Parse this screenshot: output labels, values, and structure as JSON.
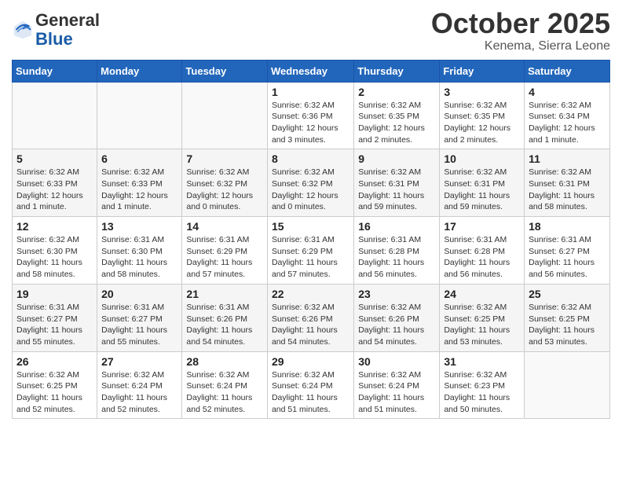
{
  "header": {
    "logo_line1": "General",
    "logo_line2": "Blue",
    "month": "October 2025",
    "location": "Kenema, Sierra Leone"
  },
  "weekdays": [
    "Sunday",
    "Monday",
    "Tuesday",
    "Wednesday",
    "Thursday",
    "Friday",
    "Saturday"
  ],
  "weeks": [
    [
      {
        "day": "",
        "info": ""
      },
      {
        "day": "",
        "info": ""
      },
      {
        "day": "",
        "info": ""
      },
      {
        "day": "1",
        "info": "Sunrise: 6:32 AM\nSunset: 6:36 PM\nDaylight: 12 hours and 3 minutes."
      },
      {
        "day": "2",
        "info": "Sunrise: 6:32 AM\nSunset: 6:35 PM\nDaylight: 12 hours and 2 minutes."
      },
      {
        "day": "3",
        "info": "Sunrise: 6:32 AM\nSunset: 6:35 PM\nDaylight: 12 hours and 2 minutes."
      },
      {
        "day": "4",
        "info": "Sunrise: 6:32 AM\nSunset: 6:34 PM\nDaylight: 12 hours and 1 minute."
      }
    ],
    [
      {
        "day": "5",
        "info": "Sunrise: 6:32 AM\nSunset: 6:33 PM\nDaylight: 12 hours and 1 minute."
      },
      {
        "day": "6",
        "info": "Sunrise: 6:32 AM\nSunset: 6:33 PM\nDaylight: 12 hours and 1 minute."
      },
      {
        "day": "7",
        "info": "Sunrise: 6:32 AM\nSunset: 6:32 PM\nDaylight: 12 hours and 0 minutes."
      },
      {
        "day": "8",
        "info": "Sunrise: 6:32 AM\nSunset: 6:32 PM\nDaylight: 12 hours and 0 minutes."
      },
      {
        "day": "9",
        "info": "Sunrise: 6:32 AM\nSunset: 6:31 PM\nDaylight: 11 hours and 59 minutes."
      },
      {
        "day": "10",
        "info": "Sunrise: 6:32 AM\nSunset: 6:31 PM\nDaylight: 11 hours and 59 minutes."
      },
      {
        "day": "11",
        "info": "Sunrise: 6:32 AM\nSunset: 6:31 PM\nDaylight: 11 hours and 58 minutes."
      }
    ],
    [
      {
        "day": "12",
        "info": "Sunrise: 6:32 AM\nSunset: 6:30 PM\nDaylight: 11 hours and 58 minutes."
      },
      {
        "day": "13",
        "info": "Sunrise: 6:31 AM\nSunset: 6:30 PM\nDaylight: 11 hours and 58 minutes."
      },
      {
        "day": "14",
        "info": "Sunrise: 6:31 AM\nSunset: 6:29 PM\nDaylight: 11 hours and 57 minutes."
      },
      {
        "day": "15",
        "info": "Sunrise: 6:31 AM\nSunset: 6:29 PM\nDaylight: 11 hours and 57 minutes."
      },
      {
        "day": "16",
        "info": "Sunrise: 6:31 AM\nSunset: 6:28 PM\nDaylight: 11 hours and 56 minutes."
      },
      {
        "day": "17",
        "info": "Sunrise: 6:31 AM\nSunset: 6:28 PM\nDaylight: 11 hours and 56 minutes."
      },
      {
        "day": "18",
        "info": "Sunrise: 6:31 AM\nSunset: 6:27 PM\nDaylight: 11 hours and 56 minutes."
      }
    ],
    [
      {
        "day": "19",
        "info": "Sunrise: 6:31 AM\nSunset: 6:27 PM\nDaylight: 11 hours and 55 minutes."
      },
      {
        "day": "20",
        "info": "Sunrise: 6:31 AM\nSunset: 6:27 PM\nDaylight: 11 hours and 55 minutes."
      },
      {
        "day": "21",
        "info": "Sunrise: 6:31 AM\nSunset: 6:26 PM\nDaylight: 11 hours and 54 minutes."
      },
      {
        "day": "22",
        "info": "Sunrise: 6:32 AM\nSunset: 6:26 PM\nDaylight: 11 hours and 54 minutes."
      },
      {
        "day": "23",
        "info": "Sunrise: 6:32 AM\nSunset: 6:26 PM\nDaylight: 11 hours and 54 minutes."
      },
      {
        "day": "24",
        "info": "Sunrise: 6:32 AM\nSunset: 6:25 PM\nDaylight: 11 hours and 53 minutes."
      },
      {
        "day": "25",
        "info": "Sunrise: 6:32 AM\nSunset: 6:25 PM\nDaylight: 11 hours and 53 minutes."
      }
    ],
    [
      {
        "day": "26",
        "info": "Sunrise: 6:32 AM\nSunset: 6:25 PM\nDaylight: 11 hours and 52 minutes."
      },
      {
        "day": "27",
        "info": "Sunrise: 6:32 AM\nSunset: 6:24 PM\nDaylight: 11 hours and 52 minutes."
      },
      {
        "day": "28",
        "info": "Sunrise: 6:32 AM\nSunset: 6:24 PM\nDaylight: 11 hours and 52 minutes."
      },
      {
        "day": "29",
        "info": "Sunrise: 6:32 AM\nSunset: 6:24 PM\nDaylight: 11 hours and 51 minutes."
      },
      {
        "day": "30",
        "info": "Sunrise: 6:32 AM\nSunset: 6:24 PM\nDaylight: 11 hours and 51 minutes."
      },
      {
        "day": "31",
        "info": "Sunrise: 6:32 AM\nSunset: 6:23 PM\nDaylight: 11 hours and 50 minutes."
      },
      {
        "day": "",
        "info": ""
      }
    ]
  ]
}
